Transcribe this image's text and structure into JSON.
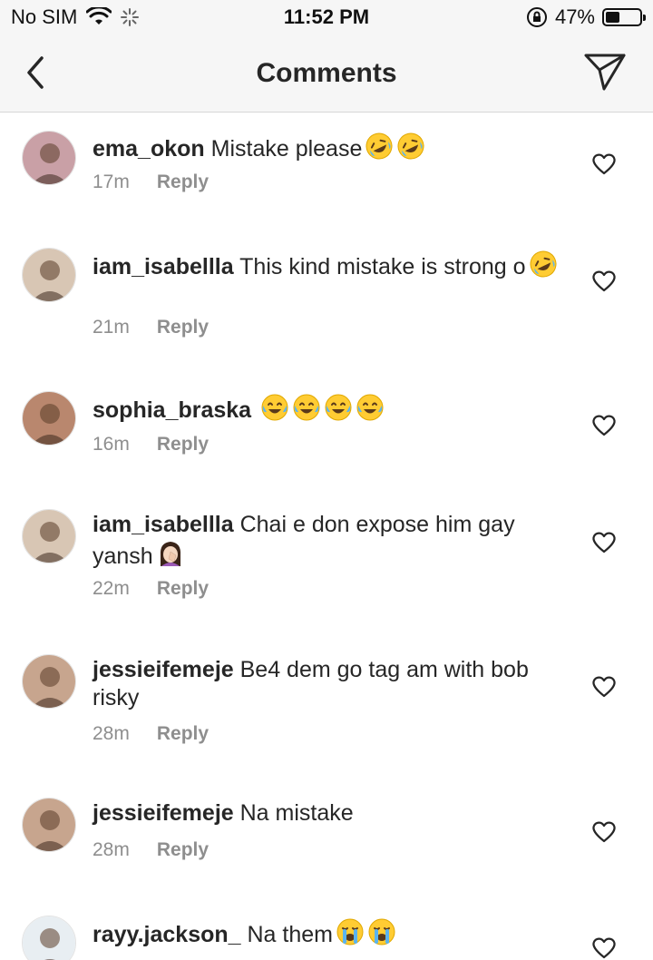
{
  "status": {
    "carrier": "No SIM",
    "time": "11:52 PM",
    "battery": "47%",
    "battery_level": 0.47
  },
  "nav": {
    "title": "Comments"
  },
  "comments": [
    {
      "username": "ema_okon",
      "text": "Mistake please",
      "emojis": [
        "rofl",
        "rofl"
      ],
      "time": "17m",
      "reply": "Reply",
      "avatar_color": "#c9a0a6"
    },
    {
      "username": "iam_isabellla",
      "text": "This kind mistake is strong o",
      "emojis": [
        "rofl"
      ],
      "time": "21m",
      "reply": "Reply",
      "avatar_color": "#d8c6b4"
    },
    {
      "username": "sophia_braska",
      "text": "",
      "emojis": [
        "joy",
        "joy",
        "joy",
        "joy"
      ],
      "time": "16m",
      "reply": "Reply",
      "avatar_color": "#b9876e"
    },
    {
      "username": "iam_isabellla",
      "text": "Chai e don expose him gay yansh",
      "emojis": [
        "facepalm"
      ],
      "time": "22m",
      "reply": "Reply",
      "avatar_color": "#d8c6b4"
    },
    {
      "username": "jessieifemeje",
      "text": "Be4 dem go tag am with bob risky",
      "emojis": [],
      "time": "28m",
      "reply": "Reply",
      "avatar_color": "#c7a58e"
    },
    {
      "username": "jessieifemeje",
      "text": "Na mistake",
      "emojis": [],
      "time": "28m",
      "reply": "Reply",
      "avatar_color": "#c7a58e"
    },
    {
      "username": "rayy.jackson_",
      "text": "Na them",
      "emojis": [
        "sob",
        "sob"
      ],
      "time": "",
      "reply": "",
      "avatar_color": "#e8eef2"
    }
  ]
}
